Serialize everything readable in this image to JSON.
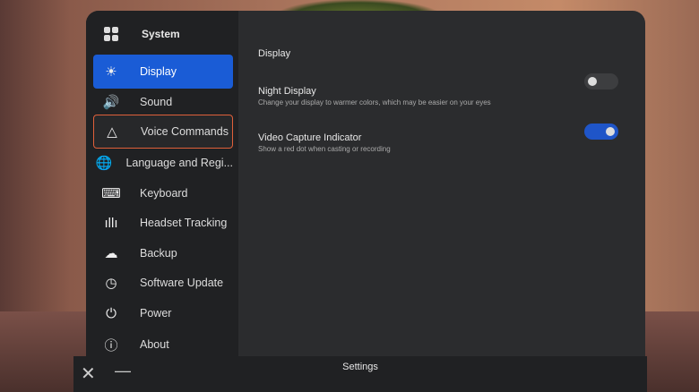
{
  "sidebar": {
    "title": "System",
    "items": [
      {
        "label": "Display",
        "icon": "sun-icon",
        "glyph": "☀"
      },
      {
        "label": "Sound",
        "icon": "speaker-icon",
        "glyph": "🔊"
      },
      {
        "label": "Voice Commands",
        "icon": "voice-triangle-icon",
        "glyph": "△"
      },
      {
        "label": "Language and Regi...",
        "icon": "globe-icon",
        "glyph": "🌐"
      },
      {
        "label": "Keyboard",
        "icon": "keyboard-icon",
        "glyph": "⌨"
      },
      {
        "label": "Headset Tracking",
        "icon": "tracking-wave-icon",
        "glyph": "ıllı"
      },
      {
        "label": "Backup",
        "icon": "cloud-icon",
        "glyph": "☁"
      },
      {
        "label": "Software Update",
        "icon": "update-clock-icon",
        "glyph": "◷"
      },
      {
        "label": "Power",
        "icon": "power-icon",
        "glyph": "⏻"
      },
      {
        "label": "About",
        "icon": "info-icon",
        "glyph": "ⓘ"
      }
    ]
  },
  "content": {
    "heading": "Display",
    "settings": [
      {
        "title": "Night Display",
        "subtitle": "Change your display to warmer colors, which may be easier on your eyes",
        "enabled": false
      },
      {
        "title": "Video Capture Indicator",
        "subtitle": "Show a red dot when casting or recording",
        "enabled": true
      }
    ]
  },
  "bottom": {
    "title": "Settings"
  },
  "colors": {
    "accent": "#1a5cd6",
    "focus": "#e0603a"
  }
}
